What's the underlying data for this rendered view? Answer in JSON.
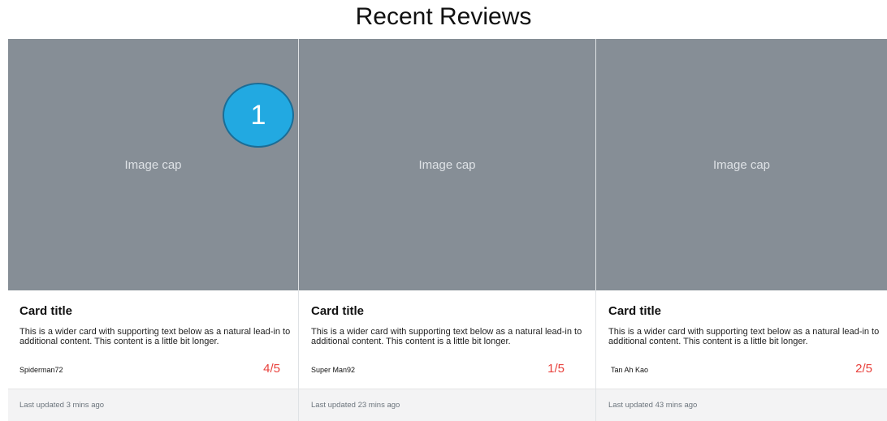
{
  "page_title": "Recent Reviews",
  "step_badge": "1",
  "cards": [
    {
      "image_cap": "Image cap",
      "title": "Card title",
      "text": "This is a wider card with supporting text below as a natural lead-in to additional content. This content is a little bit longer.",
      "author": "Spiderman72",
      "rating": "4/5",
      "footer": "Last updated 3 mins ago"
    },
    {
      "image_cap": "Image cap",
      "title": "Card title",
      "text": "This is a wider card with supporting text below as a natural lead-in to additional content. This content is a little bit longer.",
      "author": "Super Man92",
      "rating": "1/5",
      "footer": "Last updated 23 mins ago"
    },
    {
      "image_cap": "Image cap",
      "title": "Card title",
      "text": "This is a wider card with supporting text below as a natural lead-in to additional content. This content is a little bit longer.",
      "author": "Tan Ah Kao",
      "rating": "2/5",
      "footer": "Last updated 43 mins ago"
    }
  ],
  "colors": {
    "image_cap_bg": "#868e96",
    "rating": "#e8413c",
    "badge": "#22a9e1",
    "footer_bg": "#f3f3f4"
  }
}
